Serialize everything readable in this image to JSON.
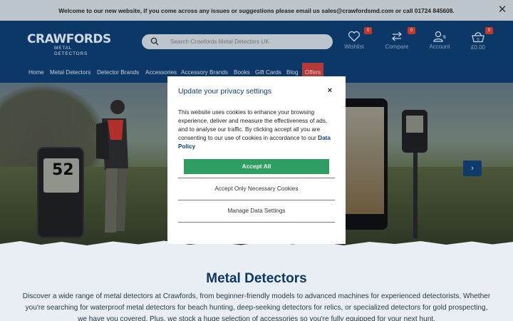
{
  "announcement": {
    "text": "Welcome to our new website, if you come across any issues or suggestions please email us sales@crawfordsmd.com or call 01724 845608.",
    "close_symbol": "✕"
  },
  "header": {
    "logo_top": "CRAWFORDS",
    "logo_bottom": "METAL DETECTORS",
    "search_placeholder": "Search Crawfords Metal Detectors UK",
    "wishlist_label": "Wishlist",
    "wishlist_count": "0",
    "compare_label": "Compare",
    "compare_count": "0",
    "account_label": "Account",
    "cart_label": "£0.00",
    "cart_count": "0"
  },
  "nav": {
    "items": [
      "Home",
      "Metal Detectors",
      "Detector Brands",
      "Accessories",
      "Accessory Brands",
      "Books",
      "Gift Cards",
      "Blog",
      "Offers"
    ]
  },
  "hero": {
    "display_number": "52",
    "next_arrow": "›"
  },
  "content": {
    "title": "Metal Detectors",
    "text": "Discover a wide range of metal detectors at Crawfords, from beginner-friendly models to advanced machines for experienced detectorists. Whether you're searching for waterproof metal detectors for beach hunting, deep-seeking detectors for relics, or specialized detectors for gold prospecting, we have you covered. Plus, we stock a huge selection of accessories so you're fully equipped for your next hunt."
  },
  "modal": {
    "title": "Update your privacy settings",
    "close_symbol": "×",
    "body": "This website uses cookies to enhance your browsing experience, deliver and measure the effectiveness of ads, and to analyse our traffic. By clicking accept all you are consenting to our use of cookies in accordance to our ",
    "link_text": "Data Policy",
    "accept_all": "Accept All",
    "accept_necessary": "Accept Only Necessary Cookies",
    "manage": "Manage Data Settings"
  },
  "colors": {
    "brand_navy": "#0c3868",
    "accept_green": "#2e9e63",
    "badge_red": "#c0392b",
    "offers_red": "#b23a3a"
  }
}
